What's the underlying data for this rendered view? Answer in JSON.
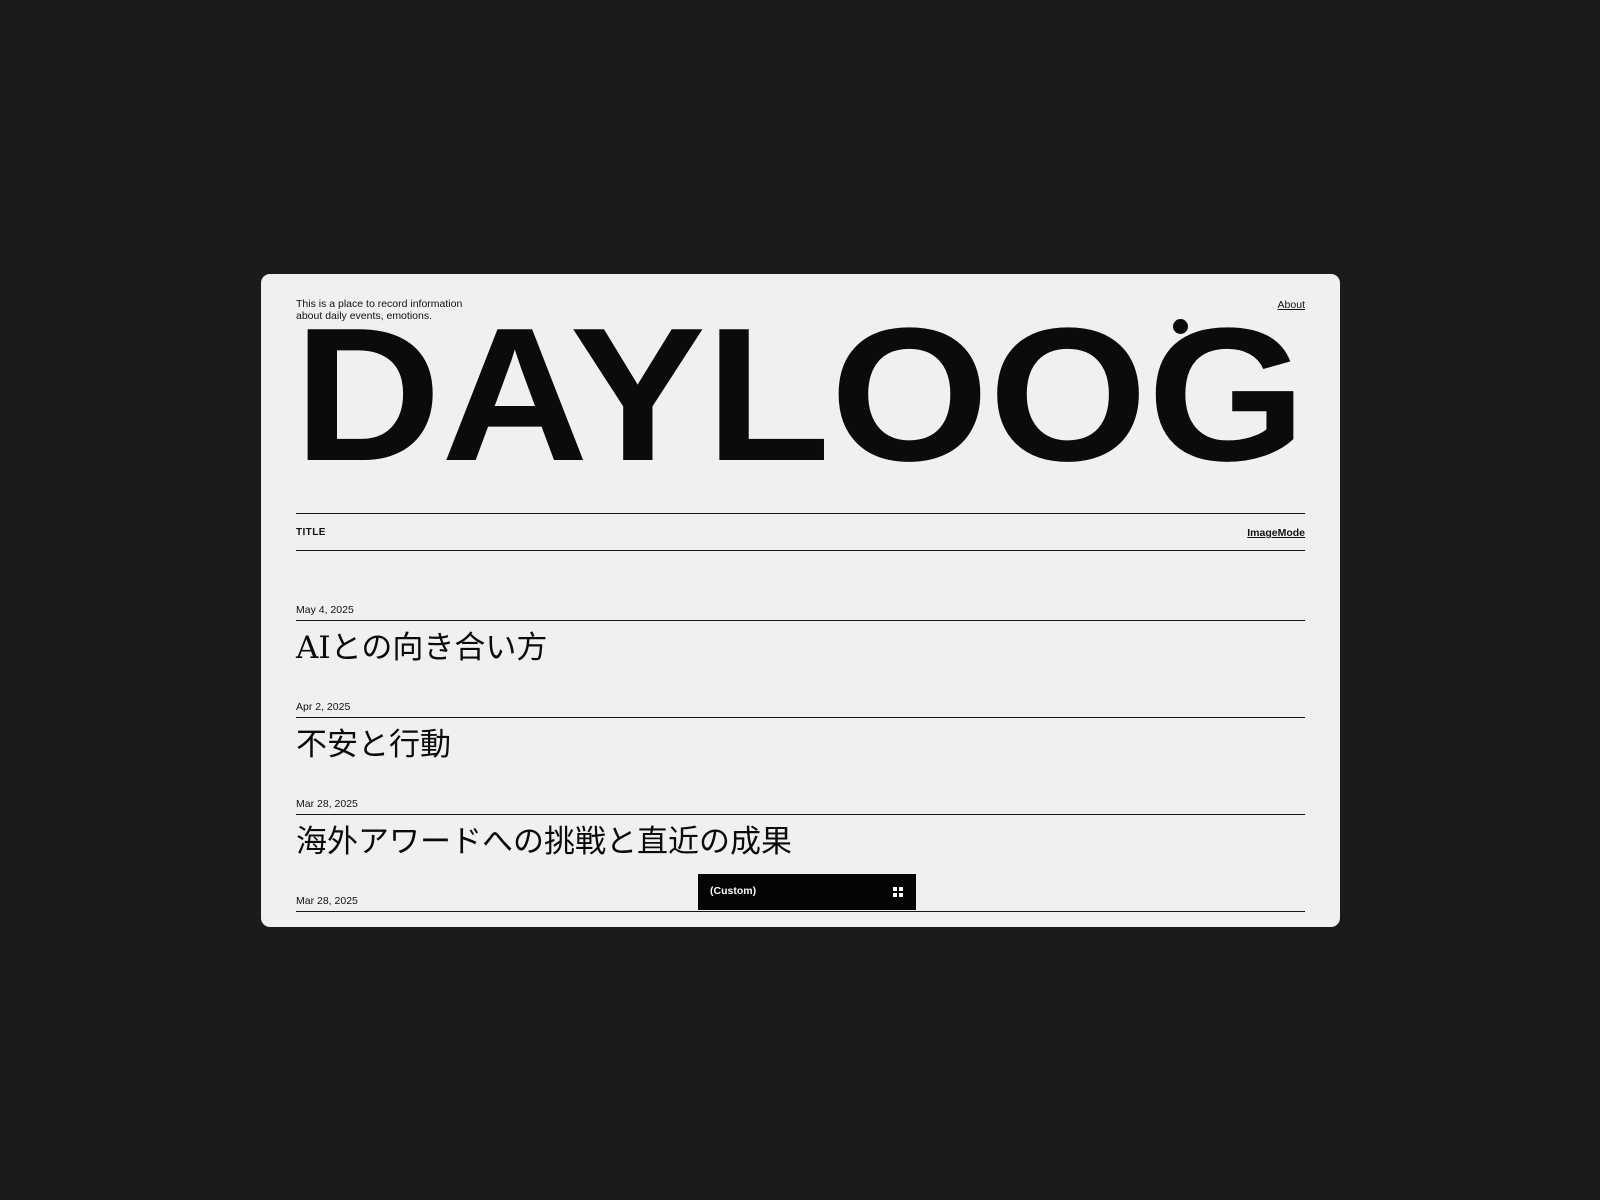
{
  "header": {
    "intro_line1": "This is a place to record information",
    "intro_line2": "about daily events, emotions.",
    "about_link": "About"
  },
  "logo": {
    "text": "DAYLOOG"
  },
  "list_header": {
    "column_title": "TITLE",
    "image_mode_link": "ImageMode"
  },
  "entries": [
    {
      "date": "May 4, 2025",
      "title": "AIとの向き合い方"
    },
    {
      "date": "Apr 2, 2025",
      "title": "不安と行動"
    },
    {
      "date": "Mar 28, 2025",
      "title": "海外アワードへの挑戦と直近の成果"
    },
    {
      "date": "Mar 28, 2025",
      "title": ""
    }
  ],
  "filter_bar": {
    "label": "(Custom)",
    "icon": "grid-icon"
  },
  "colors": {
    "background": "#1b1b1b",
    "card": "#f0f0f0",
    "ink": "#0b0b0b",
    "bar": "#050505"
  }
}
